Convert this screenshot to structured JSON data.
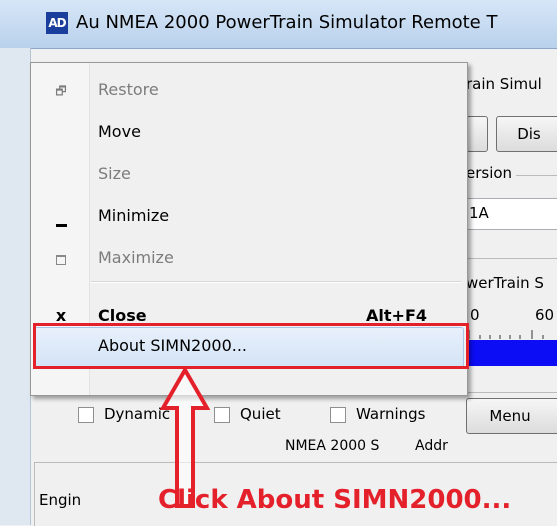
{
  "window": {
    "title": "Au NMEA 2000 PowerTrain Simulator Remote T",
    "icon_text": "AD"
  },
  "background": {
    "partial_title": "rain Simul",
    "button_partial": "Dis",
    "version_label": "ersion",
    "version_value": "1A",
    "section_partial": "werTrain S",
    "scale_0": "0",
    "scale_60": "60",
    "checkbox_dynamic": "Dynamic",
    "checkbox_quiet": "Quiet",
    "checkbox_warnings": "Warnings",
    "menu_button": "Menu",
    "bottom_partial": "NMEA 2000 S",
    "bottom_partial2": "Addr",
    "engine_partial": "Engin"
  },
  "system_menu": {
    "items": [
      {
        "label": "Restore",
        "icon": "restore-icon",
        "enabled": false,
        "shortcut": ""
      },
      {
        "label": "Move",
        "icon": "",
        "enabled": true,
        "shortcut": ""
      },
      {
        "label": "Size",
        "icon": "",
        "enabled": false,
        "shortcut": ""
      },
      {
        "label": "Minimize",
        "icon": "minimize-icon",
        "enabled": true,
        "shortcut": ""
      },
      {
        "label": "Maximize",
        "icon": "maximize-icon",
        "enabled": false,
        "shortcut": ""
      },
      {
        "label": "Close",
        "icon": "close-icon",
        "enabled": true,
        "shortcut": "Alt+F4"
      },
      {
        "label": "About SIMN2000...",
        "icon": "",
        "enabled": true,
        "shortcut": "",
        "highlighted": true
      }
    ]
  },
  "annotation": {
    "text": "Click About SIMN2000...",
    "color": "#e4202a"
  }
}
